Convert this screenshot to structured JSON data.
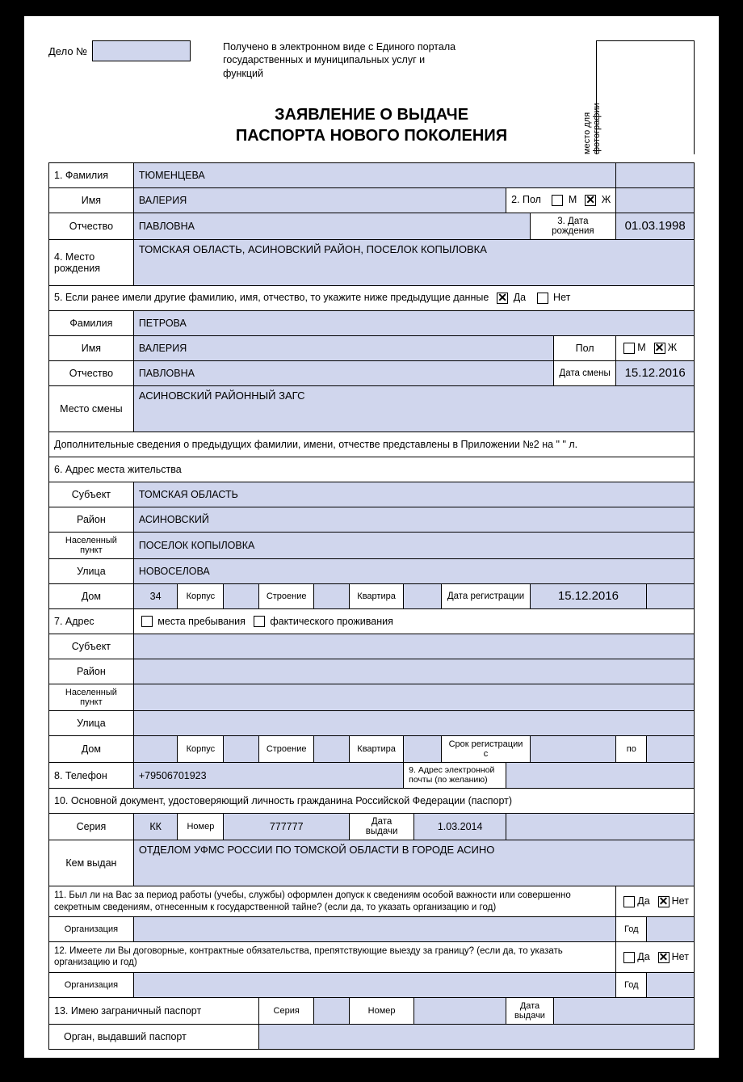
{
  "header": {
    "delo_label": "Дело №",
    "received": "Получено в электронном виде с Единого портала государственных и муниципальных услуг и функций",
    "photo_label": "место для фотографии",
    "title_line1": "ЗАЯВЛЕНИЕ О ВЫДАЧЕ",
    "title_line2": "ПАСПОРТА НОВОГО ПОКОЛЕНИЯ"
  },
  "f1": {
    "surname_label": "1. Фамилия",
    "surname": "ТЮМЕНЦЕВА",
    "name_label": "Имя",
    "name": "ВАЛЕРИЯ",
    "sex_label": "2. Пол",
    "sex_m": "М",
    "sex_f": "Ж",
    "sex_m_checked": false,
    "sex_f_checked": true,
    "patronymic_label": "Отчество",
    "patronymic": "ПАВЛОВНА",
    "dob_label": "3. Дата рождения",
    "dob": "01.03.1998"
  },
  "f4": {
    "label": "4. Место рождения",
    "value": "ТОМСКАЯ ОБЛАСТЬ, АСИНОВСКИЙ РАЙОН, ПОСЕЛОК КОПЫЛОВКА"
  },
  "f5": {
    "question": "5. Если ранее имели другие фамилию, имя, отчество, то укажите ниже предыдущие данные",
    "yes": "Да",
    "no": "Нет",
    "yes_checked": true,
    "no_checked": false,
    "surname_label": "Фамилия",
    "surname": "ПЕТРОВА",
    "name_label": "Имя",
    "name": "ВАЛЕРИЯ",
    "sex_label": "Пол",
    "sex_m": "М",
    "sex_f": "Ж",
    "sex_m_checked": false,
    "sex_f_checked": true,
    "patronymic_label": "Отчество",
    "patronymic": "ПАВЛОВНА",
    "change_date_label": "Дата смены",
    "change_date": "15.12.2016",
    "place_label": "Место смены",
    "place": "АСИНОВСКИЙ РАЙОННЫЙ ЗАГС",
    "addendum": "Дополнительные сведения о предыдущих фамилии, имени, отчестве представлены в Приложении №2 на \"        \" л."
  },
  "f6": {
    "header": "6. Адрес места жительства",
    "subject_label": "Субъект",
    "subject": "ТОМСКАЯ ОБЛАСТЬ",
    "district_label": "Район",
    "district": "АСИНОВСКИЙ",
    "locality_label": "Населенный пункт",
    "locality": "ПОСЕЛОК КОПЫЛОВКА",
    "street_label": "Улица",
    "street": "НОВОСЕЛОВА",
    "house_label": "Дом",
    "house": "34",
    "korpus_label": "Корпус",
    "korpus": "",
    "building_label": "Строение",
    "building": "",
    "flat_label": "Квартира",
    "flat": "",
    "reg_date_label": "Дата регистрации",
    "reg_date": "15.12.2016"
  },
  "f7": {
    "label": "7. Адрес",
    "stay_label": "места пребывания",
    "actual_label": "фактического проживания",
    "subject_label": "Субъект",
    "district_label": "Район",
    "locality_label": "Населенный пункт",
    "street_label": "Улица",
    "house_label": "Дом",
    "korpus_label": "Корпус",
    "building_label": "Строение",
    "flat_label": "Квартира",
    "term_label": "Срок регистрации с",
    "to_label": "по"
  },
  "f8": {
    "label": "8. Телефон",
    "phone": "+79506701923",
    "email_label": "9. Адрес электронной почты (по желанию)"
  },
  "f10": {
    "header": "10. Основной документ, удостоверяющий личность гражданина Российской Федерации (паспорт)",
    "series_label": "Серия",
    "series": "КК",
    "number_label": "Номер",
    "number": "777777",
    "issue_date_label": "Дата выдачи",
    "issue_date": "1.03.2014",
    "issuer_label": "Кем выдан",
    "issuer": "ОТДЕЛОМ УФМС РОССИИ ПО ТОМСКОЙ ОБЛАСТИ В ГОРОДЕ АСИНО"
  },
  "f11": {
    "question": "11. Был ли на Вас за период работы (учебы, службы) оформлен допуск к сведениям особой важности или совершенно секретным сведениям, отнесенным к государственной тайне? (если да, то указать организацию и год)",
    "yes": "Да",
    "no": "Нет",
    "no_checked": true,
    "org_label": "Организация",
    "year_label": "Год"
  },
  "f12": {
    "question": "12. Имеете ли Вы договорные, контрактные обязательства, препятствующие выезду за границу? (если да, то указать организацию и год)",
    "yes": "Да",
    "no": "Нет",
    "no_checked": true,
    "org_label": "Организация",
    "year_label": "Год"
  },
  "f13": {
    "label": "13. Имею заграничный паспорт",
    "series_label": "Серия",
    "number_label": "Номер",
    "issue_date_label": "Дата выдачи",
    "issuer_label": "Орган, выдавший паспорт"
  }
}
